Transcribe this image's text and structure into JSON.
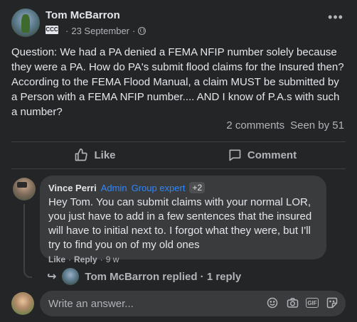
{
  "post": {
    "author": "Tom McBarron",
    "date": "23 September",
    "separator": "·",
    "group_badge": "CCC",
    "body": "Question: We had a PA denied a FEMA NFIP number solely because they were a PA. How do PA's submit flood claims for the Insured then? According to the FEMA Flood Manual, a claim MUST be submitted by a Person with a FEMA NFIP number.... AND I know of P.A.s with such a number?",
    "comments_count": "2 comments",
    "seen_by": "Seen by 51"
  },
  "actions": {
    "like_label": "Like",
    "comment_label": "Comment"
  },
  "comment": {
    "author": "Vince Perri",
    "badge_admin": "Admin",
    "badge_expert": "Group expert",
    "badge_more": "+2",
    "text": "Hey Tom. You can submit claims with your normal LOR, you just have to add in a few sentences that the insured will have to initial next to. I forgot what they were, but I'll try to find you on of my old ones",
    "like_label": "Like",
    "dot": "·",
    "reply_label": "Reply",
    "time": "9 w"
  },
  "reply_summary": {
    "text": "Tom McBarron replied · 1 reply"
  },
  "compose": {
    "placeholder": "Write an answer..."
  },
  "colors": {
    "background": "#242526",
    "bubble": "#3a3b3c",
    "accent": "#2d88ff",
    "text_primary": "#e4e6eb",
    "text_secondary": "#b0b3b8"
  },
  "icons": [
    "globe-icon",
    "more-icon",
    "like-icon",
    "comment-icon",
    "reply-arrow-icon",
    "emoji-icon",
    "camera-icon",
    "gif-icon",
    "sticker-icon"
  ]
}
